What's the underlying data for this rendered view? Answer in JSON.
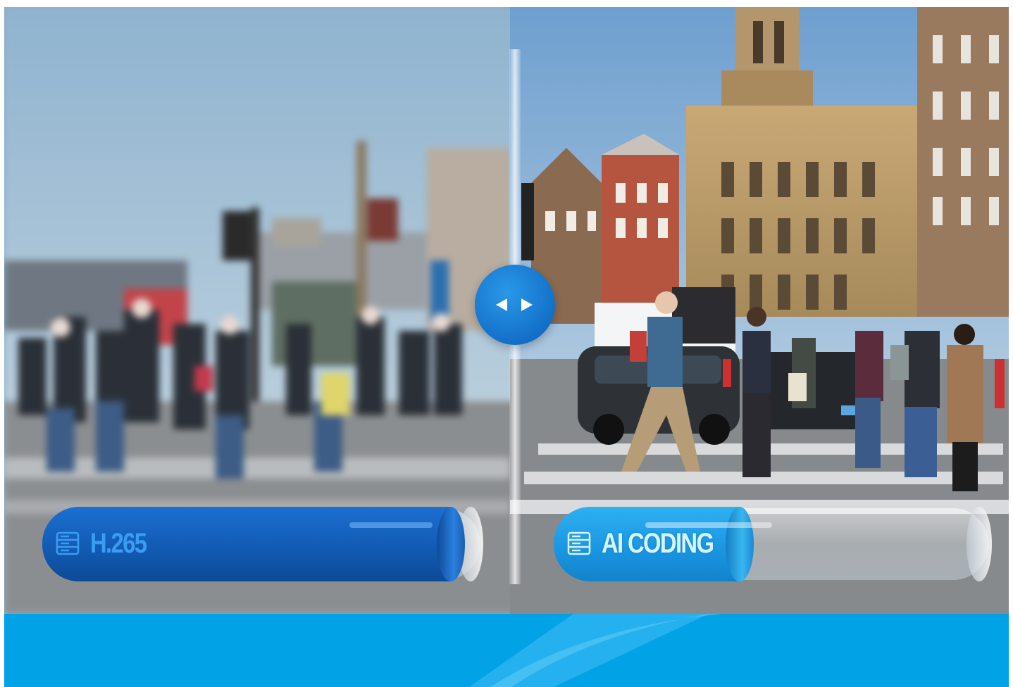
{
  "comparison": {
    "left": {
      "label": "H.265",
      "icon": "server-icon",
      "bar_level": 0.93,
      "bar_color": "#125bb4"
    },
    "right": {
      "label": "AI CODING",
      "icon": "server-icon",
      "bar_level": 0.42,
      "bar_color": "#1b97e2"
    },
    "handle_icon": "left-right-arrows-icon"
  },
  "colors": {
    "footer": "#02a2e6",
    "accent": "#1370c9"
  }
}
